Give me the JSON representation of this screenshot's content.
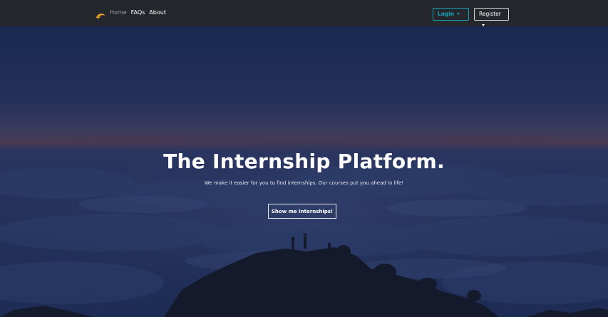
{
  "navbar": {
    "brand_icon": "tiger-logo-icon",
    "links": [
      {
        "label": "Home",
        "active": true
      },
      {
        "label": "FAQs",
        "active": false
      },
      {
        "label": "About",
        "active": false
      }
    ],
    "login_label": "Login",
    "register_label": "Register"
  },
  "hero": {
    "title": "The Internship Platform.",
    "subtitle": "We make it easier for you to find internships. Our courses put you ahead in life!",
    "cta_label": "Show me Internships!"
  },
  "colors": {
    "navbar_bg": "#24272b",
    "login_accent": "#17a2b8",
    "hero_overlay": "#1c2a4f"
  }
}
